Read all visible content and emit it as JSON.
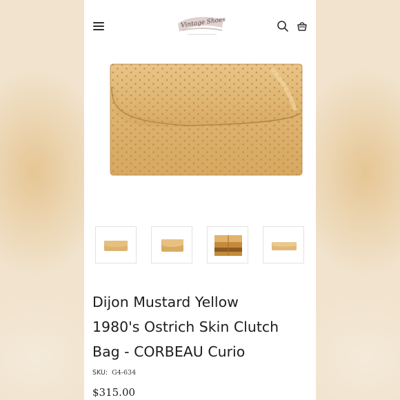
{
  "header": {
    "logo_text": "Vintage Shoes",
    "icons": {
      "menu": "hamburger-menu-icon",
      "search": "search-icon",
      "cart": "shopping-bag-icon"
    }
  },
  "product": {
    "title_lines": [
      "Dijon Mustard Yellow",
      "1980's Ostrich Skin Clutch",
      "Bag - CORBEAU Curio"
    ],
    "sku_label": "SKU:",
    "sku_value": "G4-634",
    "price": "$315.00",
    "thumbnail_count": 4
  },
  "colors": {
    "background": "#f1e3cd",
    "bag_color": "#ddb26e",
    "text": "#1d1d1d"
  }
}
